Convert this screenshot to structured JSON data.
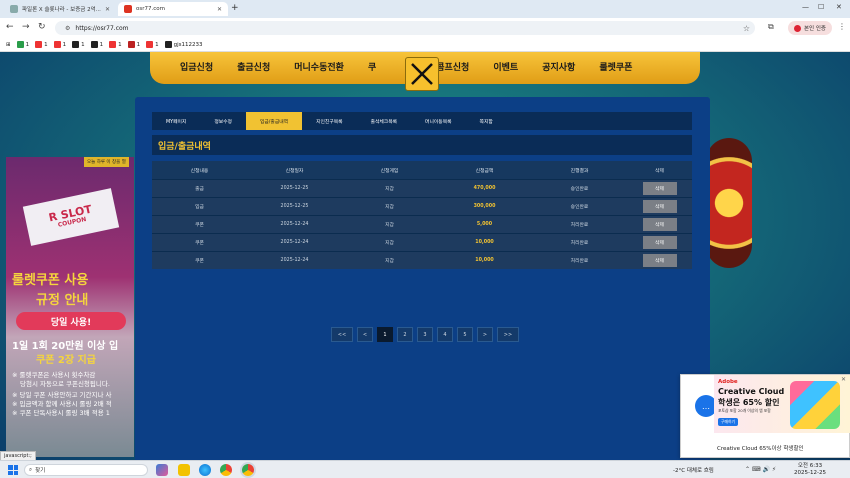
{
  "browser": {
    "tabs": [
      {
        "title": "파일론 X 슬롯나라 - 보증금 2억..."
      },
      {
        "title": "osr77.com"
      }
    ],
    "url": "https://osr77.com",
    "profile_label": "본인 인증",
    "bookmarks": [
      "1",
      "1",
      "1",
      "1",
      "1",
      "1",
      "1",
      "1",
      "gjs112233"
    ]
  },
  "site_nav": [
    "입금신청",
    "출금신청",
    "머니수동전환",
    "쿠",
    "콤프신청",
    "이벤트",
    "공지사항",
    "룰렛쿠폰"
  ],
  "left_banner": {
    "top_note": "오늘 하루 이 창을 열",
    "coupon_line1": "R SLOT",
    "coupon_line2": "COUPON",
    "headline1": "룰렛쿠폰 사용",
    "headline2": "규정 안내",
    "pill": "당일 사용!",
    "promo1": "1일 1회 20만원 이상 입",
    "promo2": "쿠폰 2장 지급",
    "note1": "※ 룰렛쿠폰은 사용시 횟수차감",
    "note2": "당첨시 자동으로 쿠폰신청됩니다.",
    "note3": "※ 당일 쿠폰 사용안하고 기간지나 사",
    "note4": "※ 입금액과 함께 사용시 롤링 2배 적",
    "note5": "※ 쿠폰 단독사용시 롤링 3배 적용 1"
  },
  "panel": {
    "tabs": [
      {
        "label": "MY페이지",
        "active": false
      },
      {
        "label": "정보수정",
        "active": false
      },
      {
        "label": "입금/출금내역",
        "active": true
      },
      {
        "label": "지인친구목록",
        "active": false
      },
      {
        "label": "출석체크목록",
        "active": false
      },
      {
        "label": "머니이동목록",
        "active": false
      },
      {
        "label": "쪽지함",
        "active": false
      }
    ],
    "section_title": "입금/출금내역",
    "table": {
      "headers": [
        "신청내용",
        "신청일자",
        "신청게임",
        "신청금액",
        "진행결과",
        "삭제"
      ],
      "rows": [
        {
          "type": "출금",
          "date": "2025-12-25",
          "game": "지갑",
          "amount": "470,000",
          "result": "승인완료",
          "delete": "삭제"
        },
        {
          "type": "입금",
          "date": "2025-12-25",
          "game": "지갑",
          "amount": "300,000",
          "result": "승인완료",
          "delete": "삭제"
        },
        {
          "type": "쿠폰",
          "date": "2025-12-24",
          "game": "지갑",
          "amount": "5,000",
          "result": "처리완료",
          "delete": "삭제"
        },
        {
          "type": "쿠폰",
          "date": "2025-12-24",
          "game": "지갑",
          "amount": "10,000",
          "result": "처리완료",
          "delete": "삭제"
        },
        {
          "type": "쿠폰",
          "date": "2025-12-24",
          "game": "지갑",
          "amount": "10,000",
          "result": "처리완료",
          "delete": "삭제"
        }
      ]
    },
    "pager": [
      "<<",
      "<",
      "1",
      "2",
      "3",
      "4",
      "5",
      ">",
      ">>"
    ],
    "pager_active": "1"
  },
  "ad": {
    "brand": "Adobe",
    "headline1": "Creative Cloud",
    "headline2": "학생은 65% 할인",
    "sub": "포토샵 포함 20개 이상의 앱 포함",
    "cta": "구매하기",
    "caption": "Creative Cloud 65%이상 학생할인"
  },
  "status_text": "javascript:;",
  "taskbar": {
    "search_label": "찾기",
    "weather": "-2°C  대체로 흐림",
    "time": "오전 6:33",
    "date": "2025-12-25"
  },
  "colors": {
    "accent": "#f1c232",
    "panel": "#0c3f86",
    "row": "#1e3b5f"
  }
}
